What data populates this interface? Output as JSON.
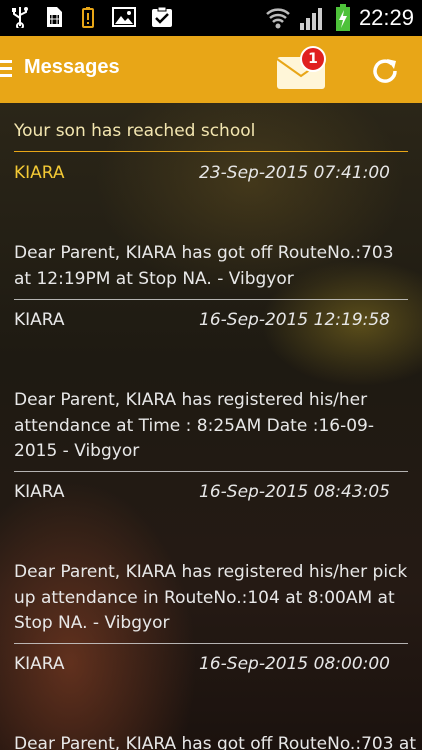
{
  "status_bar": {
    "time": "22:29",
    "icons": [
      "usb-icon",
      "sim-card-icon",
      "battery-alert-icon",
      "image-icon",
      "clipboard-check-icon",
      "wifi-icon",
      "signal-icon",
      "battery-charging-icon"
    ]
  },
  "app_bar": {
    "title": "Messages",
    "mail_badge_count": "1",
    "background_color": "#e8a617"
  },
  "section_title": "Your son has reached school",
  "messages": [
    {
      "sender": "KIARA",
      "date": "23-Sep-2015 07:41:00",
      "highlight": true
    },
    {
      "body": "Dear Parent, KIARA has got off RouteNo.:703 at 12:19PM at Stop NA. - Vibgyor",
      "sender": "KIARA",
      "date": "16-Sep-2015 12:19:58"
    },
    {
      "body": "Dear Parent, KIARA has registered his/her attendance at Time : 8:25AM Date :16-09-2015 - Vibgyor",
      "sender": "KIARA",
      "date": "16-Sep-2015 08:43:05"
    },
    {
      "body": "Dear Parent, KIARA has registered his/her pick up attendance in RouteNo.:104 at  8:00AM at Stop NA. - Vibgyor",
      "sender": "KIARA",
      "date": "16-Sep-2015 08:00:00"
    },
    {
      "body": "Dear Parent, KIARA has got off RouteNo.:703 at"
    }
  ]
}
